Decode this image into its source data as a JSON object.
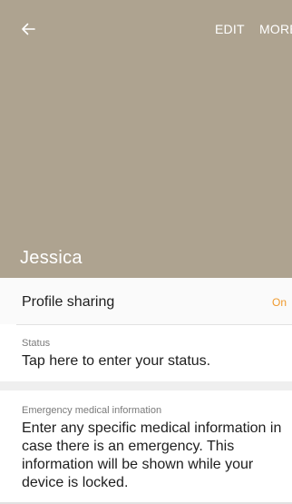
{
  "header": {
    "back_icon": "arrow-left-icon",
    "edit_label": "EDIT",
    "more_label": "MORE",
    "background_color": "#aea390"
  },
  "contact": {
    "name": "Jessica"
  },
  "profile_sharing": {
    "label": "Profile sharing",
    "value": "On",
    "value_color": "#f09a2d"
  },
  "status": {
    "caption": "Status",
    "text": "Tap here to enter your status."
  },
  "emergency": {
    "caption": "Emergency medical information",
    "text": "Enter any specific medical information in case there is an emergency. This information will be shown while your device is locked."
  }
}
